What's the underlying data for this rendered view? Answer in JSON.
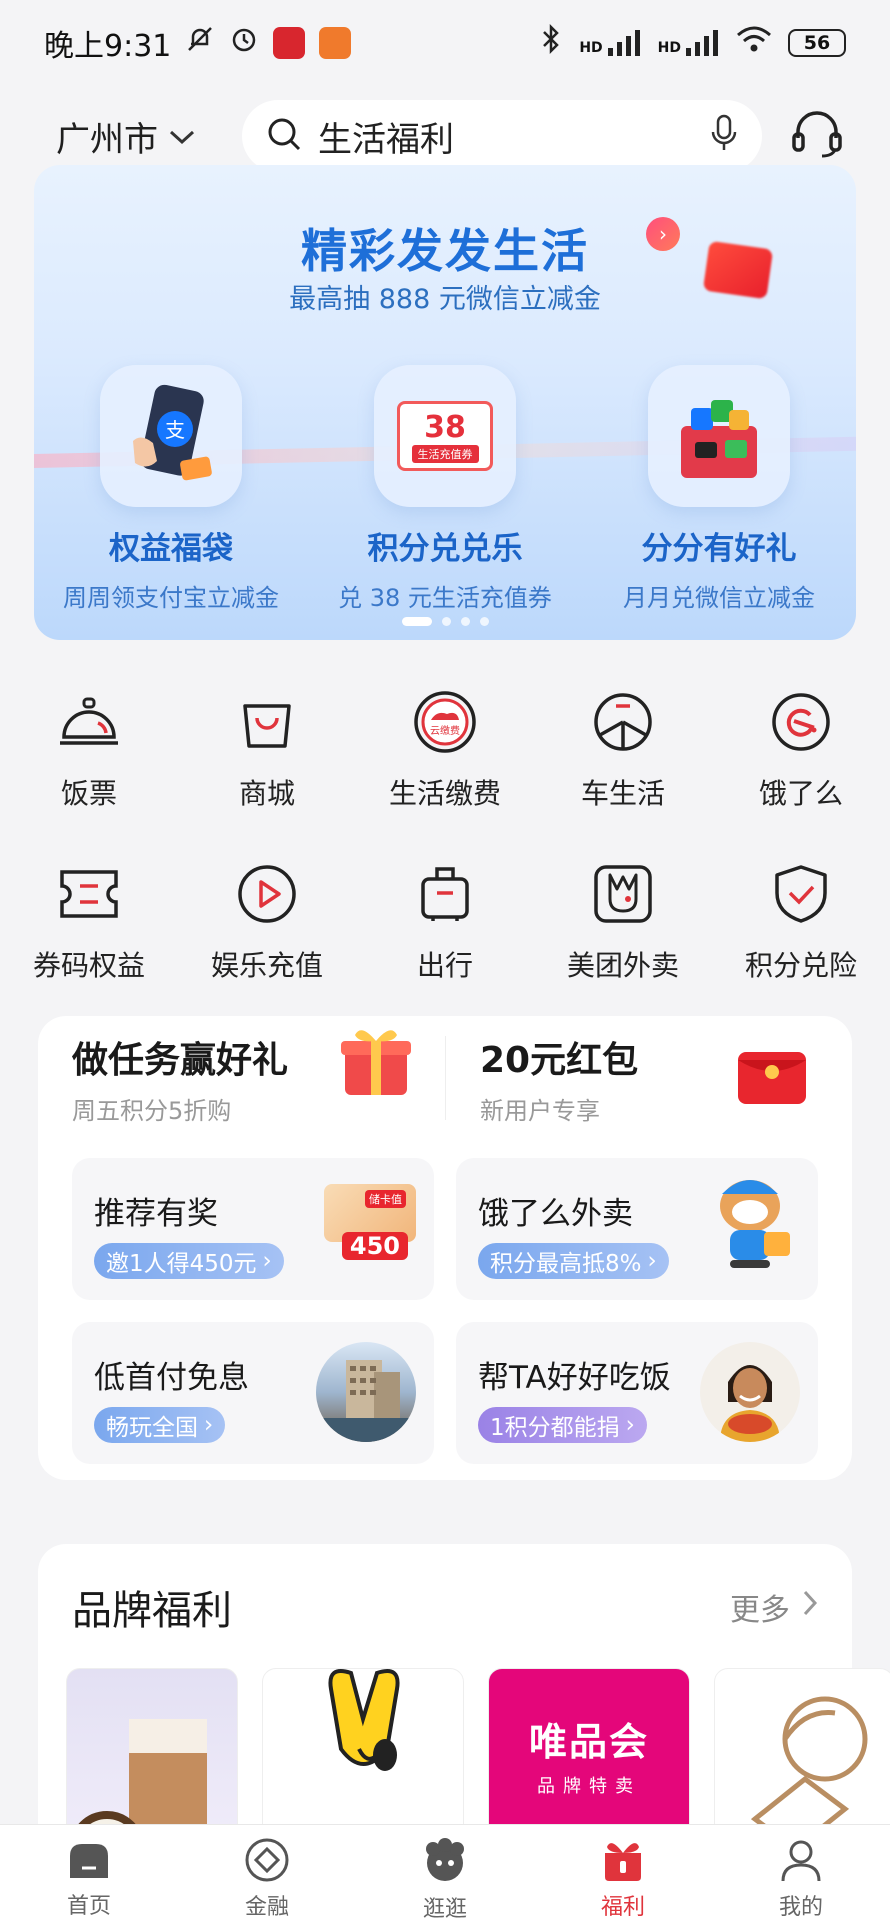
{
  "status_bar": {
    "time": "晚上9:31",
    "battery": "56",
    "signal1": "HD",
    "signal2": "HD"
  },
  "header": {
    "city": "广州市",
    "search_text": "生活福利"
  },
  "banner": {
    "title": "精彩发发生活",
    "subtitle": "最高抽 888 元微信立减金",
    "items": [
      {
        "title": "权益福袋",
        "sub": "周周领支付宝立减金"
      },
      {
        "title": "积分兑兑乐",
        "sub": "兑 38 元生活充值券",
        "badge": "38",
        "badge_sub": "生活充值券"
      },
      {
        "title": "分分有好礼",
        "sub": "月月兑微信立减金"
      }
    ]
  },
  "quick_grid": [
    {
      "label": "饭票",
      "icon": "dining-bell-icon"
    },
    {
      "label": "商城",
      "icon": "shopping-bag-icon"
    },
    {
      "label": "生活缴费",
      "icon": "cloud-payment-icon",
      "icon_text": "云缴费"
    },
    {
      "label": "车生活",
      "icon": "steering-wheel-icon"
    },
    {
      "label": "饿了么",
      "icon": "eleme-icon"
    },
    {
      "label": "券码权益",
      "icon": "coupon-icon"
    },
    {
      "label": "娱乐充值",
      "icon": "play-icon"
    },
    {
      "label": "出行",
      "icon": "luggage-icon"
    },
    {
      "label": "美团外卖",
      "icon": "meituan-rabbit-icon"
    },
    {
      "label": "积分兑险",
      "icon": "shield-check-icon"
    }
  ],
  "tasks": {
    "left_title": "做任务赢好礼",
    "left_sub": "周五积分5折购",
    "right_title": "20元红包",
    "right_sub": "新用户专享",
    "tiles": [
      {
        "title": "推荐有奖",
        "pill": "邀1人得450元",
        "art_text": "450",
        "art_label": "储卡值"
      },
      {
        "title": "饿了么外卖",
        "pill": "积分最高抵8%"
      },
      {
        "title": "低首付免息",
        "pill": "畅玩全国"
      },
      {
        "title": "帮TA好好吃饭",
        "pill": "1积分都能捐"
      }
    ]
  },
  "brand": {
    "title": "品牌福利",
    "more": "更多",
    "cards": [
      {
        "name": ""
      },
      {
        "name": ""
      },
      {
        "name": "唯品会",
        "sub": "品牌特卖"
      },
      {
        "name": ""
      }
    ]
  },
  "tabbar": [
    {
      "label": "首页",
      "icon": "home-icon"
    },
    {
      "label": "金融",
      "icon": "finance-icon"
    },
    {
      "label": "逛逛",
      "icon": "browse-icon"
    },
    {
      "label": "福利",
      "icon": "gift-icon",
      "active": true
    },
    {
      "label": "我的",
      "icon": "profile-icon"
    }
  ],
  "colors": {
    "accent_red": "#e0343c",
    "banner_blue": "#1e6fd8"
  }
}
